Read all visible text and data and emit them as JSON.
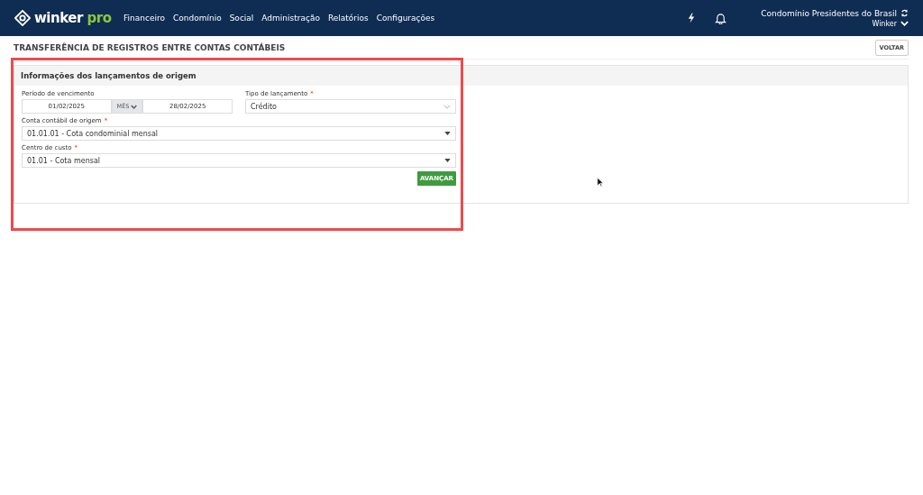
{
  "header": {
    "logo": {
      "word": "winker",
      "accent": "pro"
    },
    "nav": [
      "Financeiro",
      "Condomínio",
      "Social",
      "Administração",
      "Relatórios",
      "Configurações"
    ],
    "account": {
      "name": "Condomínio Presidentes do Brasil",
      "user": "Winker"
    }
  },
  "page": {
    "title": "TRANSFERÊNCIA DE REGISTROS ENTRE CONTAS CONTÁBEIS",
    "back_button": "VOLTAR"
  },
  "panel": {
    "title": "Informações dos lançamentos de origem",
    "period": {
      "label": "Período de vencimento",
      "start": "01/02/2025",
      "unit": "MÊS",
      "end": "28/02/2025"
    },
    "type": {
      "label": "Tipo de lançamento",
      "required_mark": "*",
      "value": "Crédito"
    },
    "fields": [
      {
        "label": "Conta contábil de origem",
        "required_mark": "*",
        "value": "01.01.01 - Cota condominial mensal"
      },
      {
        "label": "Centro de custo",
        "required_mark": "*",
        "value": "01.01 - Cota mensal"
      }
    ],
    "submit": "AVANÇAR"
  },
  "annotations": [
    {
      "kind": "highlight-frame"
    }
  ]
}
